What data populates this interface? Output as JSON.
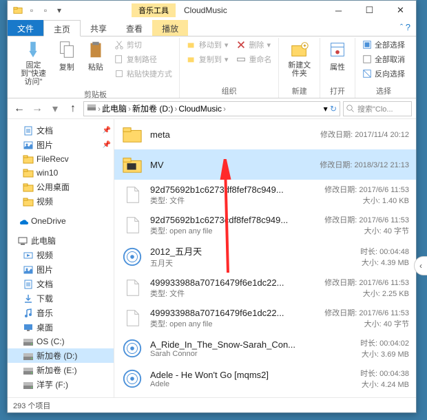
{
  "titlebar": {
    "context_tab": "音乐工具",
    "title": "CloudMusic"
  },
  "tabs": {
    "file": "文件",
    "home": "主页",
    "share": "共享",
    "view": "查看",
    "play": "播放"
  },
  "ribbon": {
    "pin": "固定到\"快速访问\"",
    "copy": "复制",
    "paste": "粘贴",
    "copypath": "复制路径",
    "pasteshortcut": "粘贴快捷方式",
    "cut": "剪切",
    "clipboard": "剪贴板",
    "moveto": "移动到",
    "copyto": "复制到",
    "delete": "删除",
    "rename": "重命名",
    "organize": "组织",
    "newfolder": "新建文件夹",
    "new": "新建",
    "properties": "属性",
    "open": "打开",
    "selectall": "全部选择",
    "selectnone": "全部取消",
    "invert": "反向选择",
    "select": "选择"
  },
  "breadcrumbs": [
    "此电脑",
    "新加卷 (D:)",
    "CloudMusic"
  ],
  "search_placeholder": "搜索\"Clo...",
  "nav": {
    "items": [
      {
        "icon": "doc",
        "label": "文档",
        "pin": true
      },
      {
        "icon": "pic",
        "label": "图片",
        "pin": true
      },
      {
        "icon": "folder",
        "label": "FileRecv"
      },
      {
        "icon": "folder",
        "label": "win10"
      },
      {
        "icon": "folder",
        "label": "公用桌面"
      },
      {
        "icon": "folder",
        "label": "视频"
      }
    ],
    "onedrive": "OneDrive",
    "thispc": "此电脑",
    "pc": [
      {
        "icon": "vid",
        "label": "视频"
      },
      {
        "icon": "pic",
        "label": "图片"
      },
      {
        "icon": "doc",
        "label": "文档"
      },
      {
        "icon": "dl",
        "label": "下载"
      },
      {
        "icon": "mus",
        "label": "音乐"
      },
      {
        "icon": "desk",
        "label": "桌面"
      },
      {
        "icon": "drive",
        "label": "OS (C:)"
      },
      {
        "icon": "drive",
        "label": "新加卷 (D:)",
        "sel": true
      },
      {
        "icon": "drive",
        "label": "新加卷 (E:)"
      },
      {
        "icon": "drive",
        "label": "洋芋 (F:)"
      }
    ]
  },
  "files": [
    {
      "icon": "folder",
      "name": "meta",
      "r1": "修改日期: 2017/11/4 20:12",
      "r2": ""
    },
    {
      "icon": "folder-mv",
      "name": "MV",
      "r1": "修改日期: 2018/3/12 21:13",
      "r2": "",
      "sel": true
    },
    {
      "icon": "file",
      "name": "92d75692b1c6273df8fef78c949...",
      "sub": "类型: 文件",
      "r1": "修改日期: 2017/6/6 11:53",
      "r2": "大小: 1.40 KB"
    },
    {
      "icon": "file",
      "name": "92d75692b1c6273cdf8fef78c949...",
      "sub": "类型: open any file",
      "r1": "修改日期: 2017/6/6 11:53",
      "r2": "大小: 40 字节"
    },
    {
      "icon": "music",
      "name": "2012_五月天",
      "sub": "五月天",
      "r1": "时长: 00:04:48",
      "r2": "大小: 4.39 MB"
    },
    {
      "icon": "file",
      "name": "499933988a70716479f6e1dc22...",
      "sub": "类型: 文件",
      "r1": "修改日期: 2017/6/6 11:53",
      "r2": "大小: 2.25 KB"
    },
    {
      "icon": "file",
      "name": "499933988a70716479f6e1dc22...",
      "sub": "类型: open any file",
      "r1": "修改日期: 2017/6/6 11:53",
      "r2": "大小: 40 字节"
    },
    {
      "icon": "music",
      "name": "A_Ride_In_The_Snow-Sarah_Con...",
      "sub": "Sarah Connor",
      "r1": "时长: 00:04:02",
      "r2": "大小: 3.69 MB"
    },
    {
      "icon": "music",
      "name": "Adele - He Won't Go [mqms2]",
      "sub": "Adele",
      "r1": "时长: 00:04:38",
      "r2": "大小: 4.24 MB"
    }
  ],
  "status": "293 个项目"
}
